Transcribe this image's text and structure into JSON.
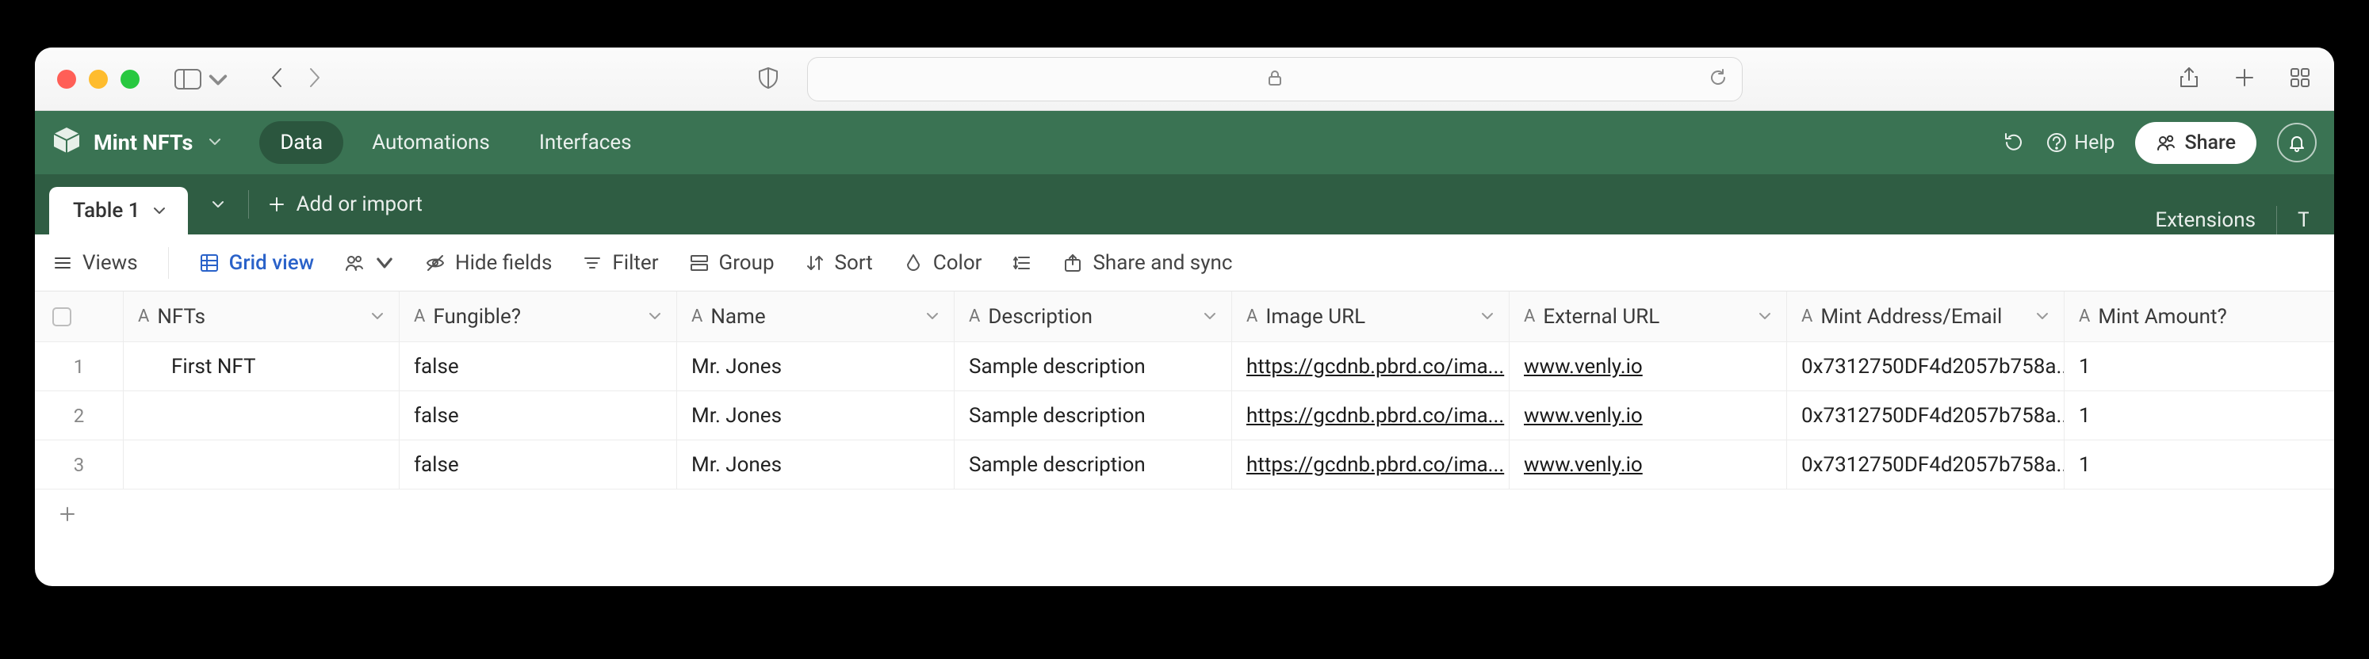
{
  "browser": {},
  "app": {
    "base_name": "Mint NFTs",
    "tabs": {
      "data": "Data",
      "automations": "Automations",
      "interfaces": "Interfaces"
    },
    "help": "Help",
    "share": "Share"
  },
  "table_tabs": {
    "active": "Table 1",
    "add_or_import": "Add or import",
    "extensions": "Extensions",
    "tools_initial": "T"
  },
  "view_toolbar": {
    "views": "Views",
    "grid_view": "Grid view",
    "hide_fields": "Hide fields",
    "filter": "Filter",
    "group": "Group",
    "sort": "Sort",
    "color": "Color",
    "share_sync": "Share and sync"
  },
  "columns": [
    {
      "label": "NFTs",
      "type": "A"
    },
    {
      "label": "Fungible?",
      "type": "A"
    },
    {
      "label": "Name",
      "type": "A"
    },
    {
      "label": "Description",
      "type": "A"
    },
    {
      "label": "Image URL",
      "type": "A"
    },
    {
      "label": "External URL",
      "type": "A"
    },
    {
      "label": "Mint Address/Email",
      "type": "A"
    },
    {
      "label": "Mint Amount?",
      "type": "A"
    }
  ],
  "rows": [
    {
      "num": "1",
      "nfts": "First NFT",
      "fungible": "false",
      "name": "Mr. Jones",
      "description": "Sample description",
      "image_url": "https://gcdnb.pbrd.co/ima...",
      "external_url": "www.venly.io",
      "mint_addr": "0x7312750DF4d2057b758a...",
      "mint_amount": "1"
    },
    {
      "num": "2",
      "nfts": "",
      "fungible": "false",
      "name": "Mr. Jones",
      "description": "Sample description",
      "image_url": "https://gcdnb.pbrd.co/ima...",
      "external_url": "www.venly.io",
      "mint_addr": "0x7312750DF4d2057b758a...",
      "mint_amount": "1"
    },
    {
      "num": "3",
      "nfts": "",
      "fungible": "false",
      "name": "Mr. Jones",
      "description": "Sample description",
      "image_url": "https://gcdnb.pbrd.co/ima...",
      "external_url": "www.venly.io",
      "mint_addr": "0x7312750DF4d2057b758a...",
      "mint_amount": "1"
    }
  ]
}
